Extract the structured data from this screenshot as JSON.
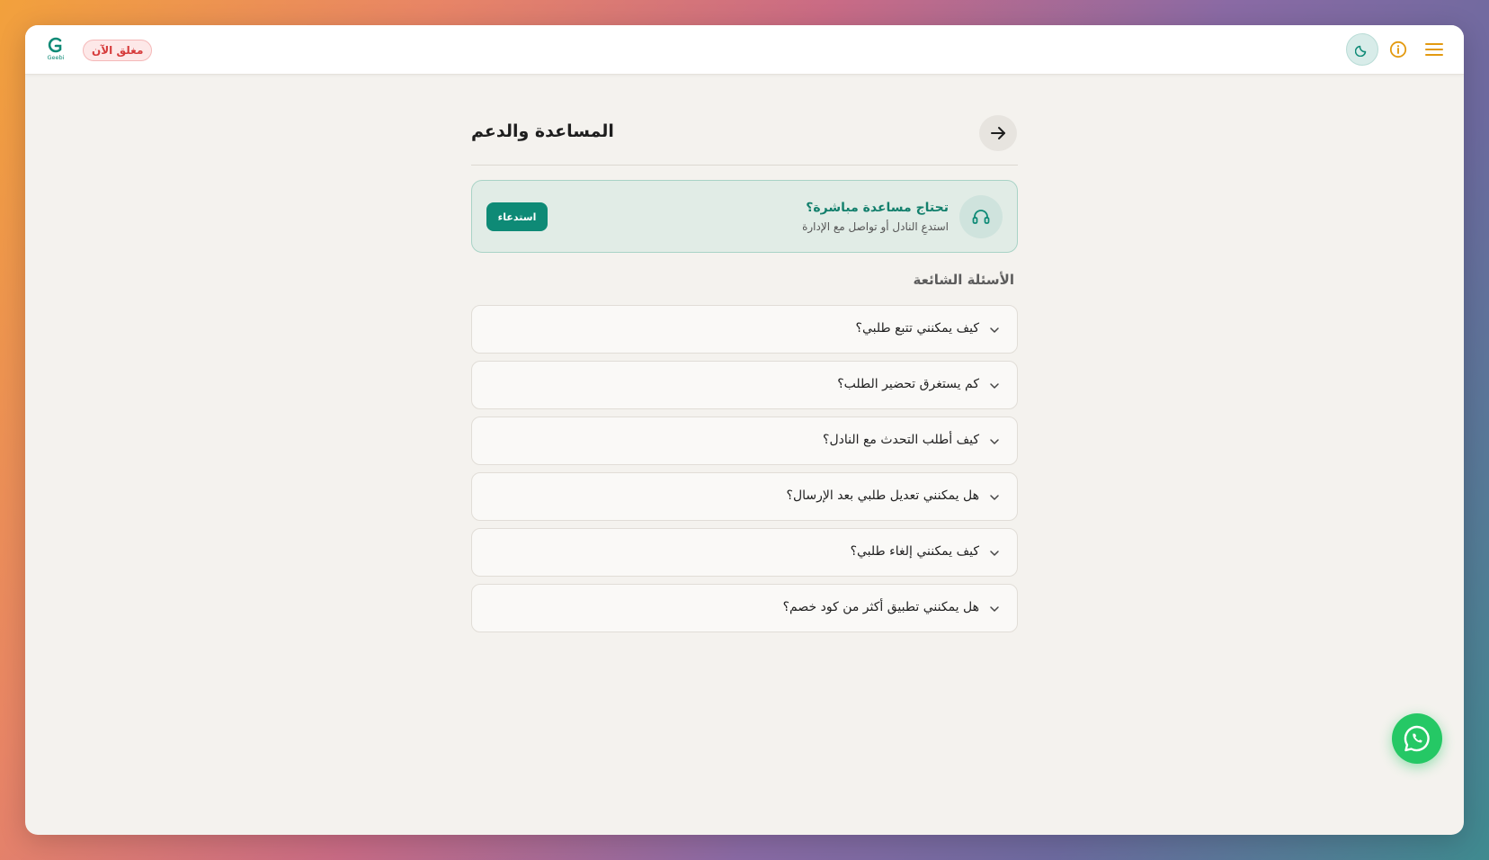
{
  "header": {
    "logo_text": "Geebi",
    "status_badge": "مغلق الآن",
    "icons": [
      "moon-icon",
      "info-icon",
      "menu-icon"
    ]
  },
  "page": {
    "title": "المساعدة والدعم",
    "back_icon": "arrow-right-icon"
  },
  "help_card": {
    "title": "تحتاج مساعدة مباشرة؟",
    "subtitle": "استدعِ النادل أو تواصل مع الإدارة",
    "button_label": "استدعاء",
    "icon": "headset-icon"
  },
  "faq": {
    "heading": "الأسئلة الشائعة",
    "items": [
      {
        "question": "كيف يمكنني تتبع طلبي؟"
      },
      {
        "question": "كم يستغرق تحضير الطلب؟"
      },
      {
        "question": "كيف أطلب التحدث مع النادل؟"
      },
      {
        "question": "هل يمكنني تعديل طلبي بعد الإرسال؟"
      },
      {
        "question": "كيف يمكنني إلغاء طلبي؟"
      },
      {
        "question": "هل يمكنني تطبيق أكثر من كود خصم؟"
      }
    ]
  },
  "floating": {
    "icon": "whatsapp-icon"
  },
  "colors": {
    "accent": "#0e8a76",
    "status_closed": "#d63b3b",
    "info": "#e39a10",
    "whatsapp": "#25c865"
  }
}
